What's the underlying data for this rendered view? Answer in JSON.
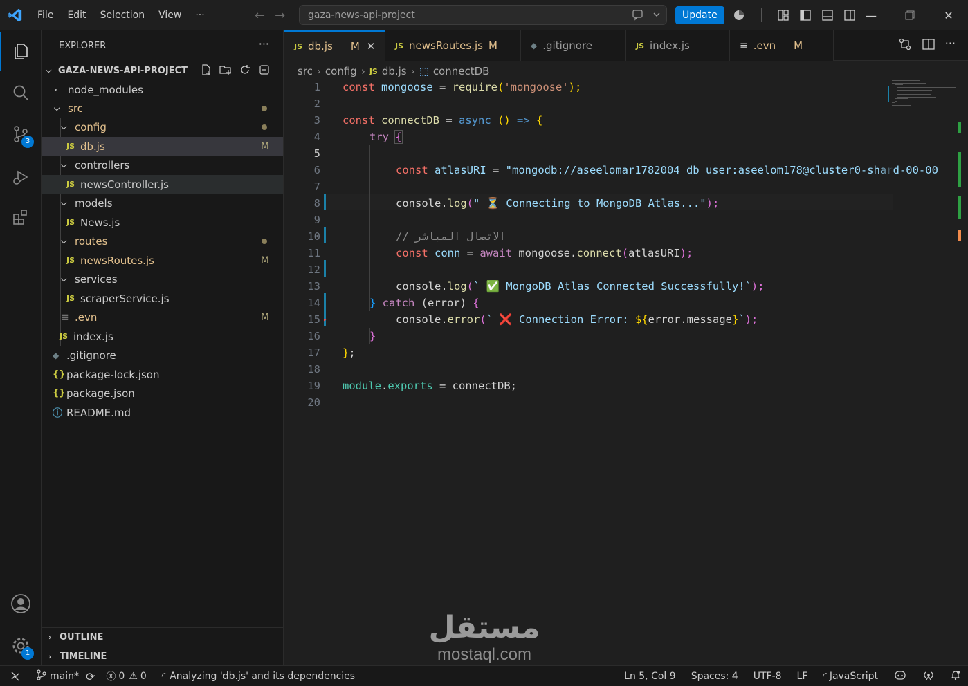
{
  "menu": [
    "File",
    "Edit",
    "Selection",
    "View",
    "···"
  ],
  "search": {
    "text": "gaza-news-api-project"
  },
  "update_label": "Update",
  "explorer": {
    "title": "EXPLORER",
    "more": "···",
    "project": "GAZA-NEWS-API-PROJECT",
    "items": [
      {
        "label": "node_modules",
        "kind": "folder-closed"
      },
      {
        "label": "src",
        "kind": "folder-open"
      },
      {
        "label": "config",
        "kind": "folder-open"
      },
      {
        "label": "db.js",
        "kind": "js",
        "status": "M"
      },
      {
        "label": "controllers",
        "kind": "folder-open"
      },
      {
        "label": "newsController.js",
        "kind": "js"
      },
      {
        "label": "models",
        "kind": "folder-open"
      },
      {
        "label": "News.js",
        "kind": "js"
      },
      {
        "label": "routes",
        "kind": "folder-open"
      },
      {
        "label": "newsRoutes.js",
        "kind": "js",
        "status": "M"
      },
      {
        "label": "services",
        "kind": "folder-open"
      },
      {
        "label": "scraperService.js",
        "kind": "js"
      },
      {
        "label": ".evn",
        "kind": "text",
        "status": "M"
      },
      {
        "label": "index.js",
        "kind": "js"
      },
      {
        "label": ".gitignore",
        "kind": "git"
      },
      {
        "label": "package-lock.json",
        "kind": "json"
      },
      {
        "label": "package.json",
        "kind": "json"
      },
      {
        "label": "README.md",
        "kind": "info"
      }
    ],
    "outline": "OUTLINE",
    "timeline": "TIMELINE",
    "icon_js": "JS",
    "icon_json": "{}"
  },
  "activity_badges": {
    "source_control": "3",
    "settings": "1"
  },
  "tabs": [
    {
      "label": "db.js",
      "icon": "JS",
      "status": "M",
      "close": "✕"
    },
    {
      "label": "newsRoutes.js",
      "icon": "JS",
      "status": "M"
    },
    {
      "label": ".gitignore",
      "icon": ""
    },
    {
      "label": "index.js",
      "icon": "JS"
    },
    {
      "label": ".evn",
      "icon": "",
      "status": "M"
    }
  ],
  "breadcrumb": {
    "src": "src",
    "config": "config",
    "file": "db.js",
    "symbol": "connectDB",
    "js": "JS"
  },
  "code": {
    "line_numbers": [
      "1",
      "2",
      "3",
      "4",
      "5",
      "6",
      "7",
      "8",
      "9",
      "10",
      "11",
      "12",
      "13",
      "14",
      "15",
      "16",
      "17",
      "18",
      "19",
      "20"
    ],
    "l1": [
      "const",
      " mongoose",
      " = ",
      "require",
      "(",
      "'mongoose'",
      ");"
    ],
    "l3": [
      "const",
      " connectDB",
      " = ",
      "async",
      " ",
      "()",
      " => ",
      "{"
    ],
    "l4": [
      "try",
      " ",
      "{"
    ],
    "l6": [
      "const",
      " atlasURI",
      " = ",
      "\"mongodb://aseelomar1782004_db_user:aseelom178@cluster0-shard-00-00"
    ],
    "l8": [
      "console",
      ".",
      "log",
      "(",
      "\" ⏳ Connecting to MongoDB Atlas...\"",
      ");"
    ],
    "l10": "// الاتصال المباشر",
    "l11": [
      "const",
      " conn",
      " = ",
      "await",
      " mongoose",
      ".",
      "connect",
      "(",
      "atlasURI",
      ");"
    ],
    "l13": [
      "console",
      ".",
      "log",
      "(",
      "` ✅ MongoDB Atlas Connected Successfully!`",
      ");"
    ],
    "l14": [
      "}",
      " catch ",
      "(",
      "error",
      ") ",
      "{"
    ],
    "l15": [
      "console",
      ".",
      "error",
      "(",
      "` ❌ Connection Error: ",
      "${",
      "error",
      ".",
      "message",
      "}",
      "`",
      ");"
    ],
    "l16": "}",
    "l17": [
      "}",
      ";"
    ],
    "l19": [
      "module",
      ".",
      "exports",
      " = ",
      "connectDB",
      ";"
    ]
  },
  "status": {
    "branch": "main*",
    "errors": "0",
    "warnings": "0",
    "analyzing": "Analyzing 'db.js' and its dependencies",
    "position": "Ln 5, Col 9",
    "spaces": "Spaces: 4",
    "encoding": "UTF-8",
    "eol": "LF",
    "language": "JavaScript"
  },
  "watermark": {
    "arabic": "مستقل",
    "latin": "mostaql.com"
  }
}
